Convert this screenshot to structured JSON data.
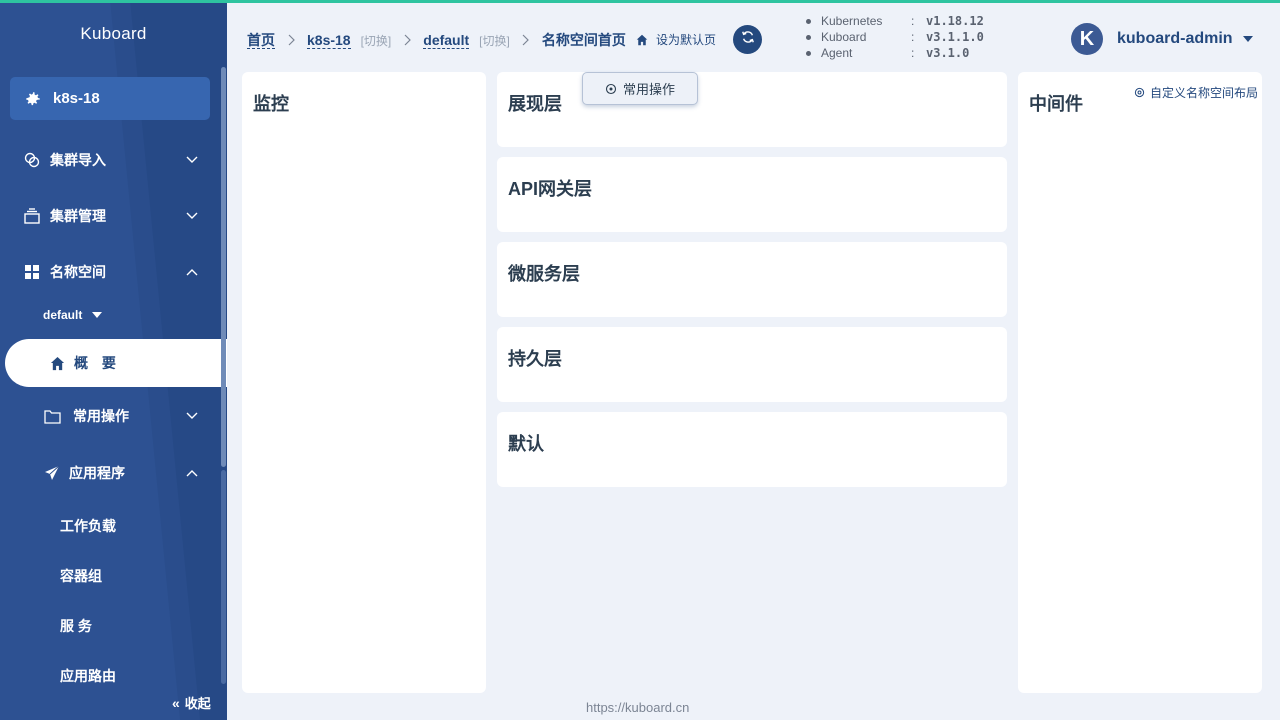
{
  "sidebar": {
    "brand": "Kuboard",
    "cluster": "k8s-18",
    "menu": [
      {
        "label": "集群导入"
      },
      {
        "label": "集群管理"
      },
      {
        "label": "名称空间"
      }
    ],
    "namespace_select": "default",
    "active_item": "概 要",
    "common_ops": "常用操作",
    "apps": "应用程序",
    "sub_items": [
      "工作负载",
      "容器组",
      "服 务",
      "应用路由"
    ],
    "collapse": "收起"
  },
  "breadcrumb": {
    "home": "首页",
    "cluster": "k8s-18",
    "switch": "[切换]",
    "namespace": "default",
    "current": "名称空间首页",
    "set_default": "设为默认页"
  },
  "versions": [
    {
      "name": "Kubernetes",
      "sep": ":",
      "value": "v1.18.12"
    },
    {
      "name": "Kuboard",
      "sep": ":",
      "value": "v3.1.1.0"
    },
    {
      "name": "Agent",
      "sep": ":",
      "value": "v3.1.0"
    }
  ],
  "user": {
    "avatar_letter": "K",
    "name": "kuboard-admin"
  },
  "panels": {
    "monitor": "监控",
    "presentation": "展现层",
    "api_gateway": "API网关层",
    "microservice": "微服务层",
    "persistence": "持久层",
    "default": "默认",
    "middleware": "中间件"
  },
  "popup_button": "常用操作",
  "customize_layout": "自定义名称空间布局",
  "footer": "https://kuboard.cn",
  "colors": {
    "sidebar": "#2a4d8c",
    "accent": "#2ec4a0",
    "primary": "#24497e",
    "background": "#eef2f9"
  },
  "icons": {
    "cluster": "gear-icon",
    "import": "link-icon",
    "manage": "stack-icon",
    "namespace": "grid-icon",
    "overview": "home-icon",
    "common_ops": "folder-icon",
    "apps": "paper-plane-icon",
    "collapse": "double-chevron-left-icon",
    "refresh": "refresh-icon",
    "set_default": "home-icon",
    "customize": "settings-icon"
  }
}
